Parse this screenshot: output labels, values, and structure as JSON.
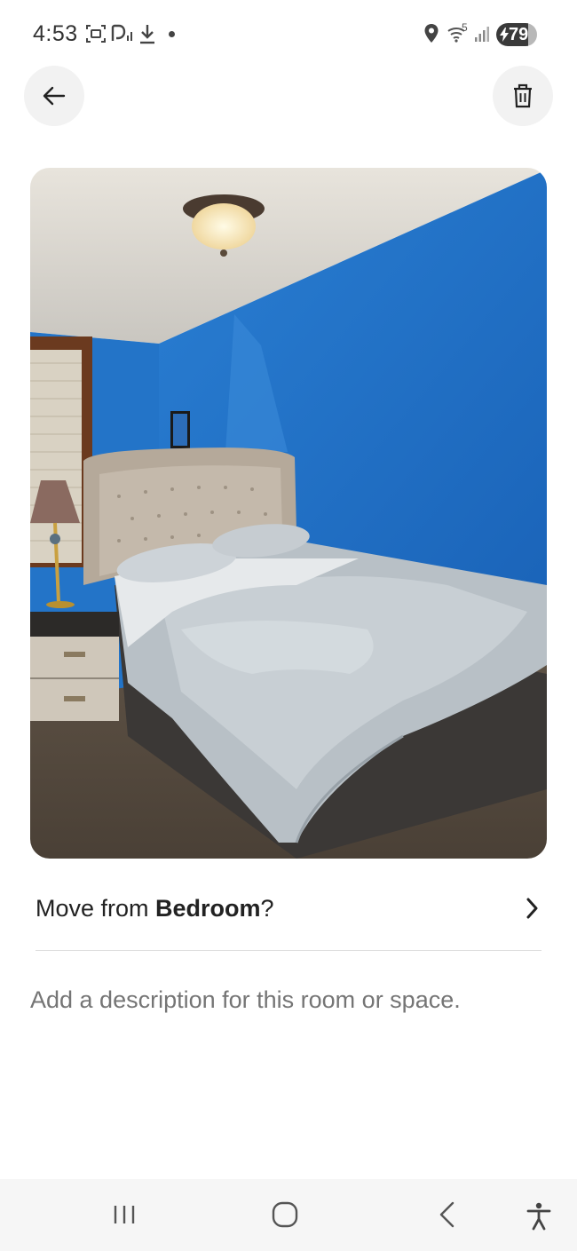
{
  "status_bar": {
    "time": "4:53",
    "battery_level": "79",
    "network_label": "5",
    "icons": [
      "screenshot-icon",
      "nfc-icon",
      "download-icon",
      "notification-dot",
      "location-icon",
      "wifi-icon",
      "signal-icon",
      "battery-icon"
    ]
  },
  "toolbar": {
    "back_icon": "arrow-left-icon",
    "delete_icon": "trash-icon"
  },
  "photo": {
    "subject": "bedroom-photo"
  },
  "move_row": {
    "prefix": "Move from ",
    "room": "Bedroom",
    "suffix": "?",
    "chevron_icon": "chevron-right-icon"
  },
  "description": {
    "placeholder": "Add a description for this room or space."
  },
  "nav_bar": {
    "icons": [
      "recent-apps-icon",
      "home-icon",
      "back-icon",
      "accessibility-icon"
    ]
  },
  "colors": {
    "text_primary": "#222222",
    "text_secondary": "#6a6a6a",
    "button_bg": "#f2f2f2",
    "divider": "#dddddd",
    "wall_blue": "#1f6fc4"
  }
}
